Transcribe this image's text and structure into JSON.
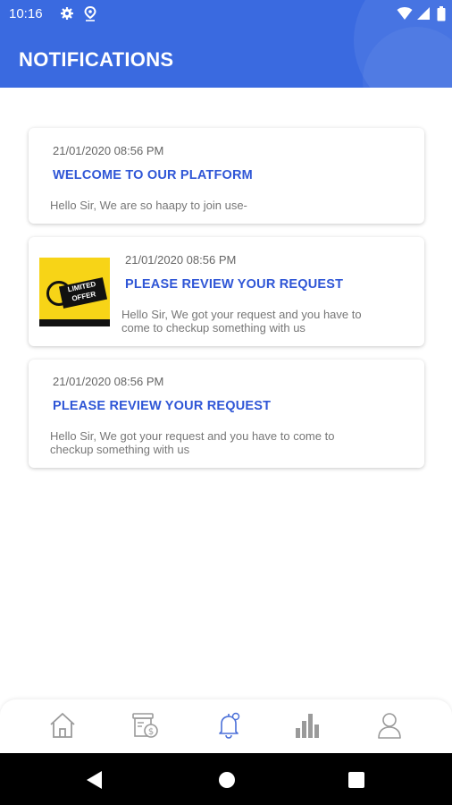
{
  "status_bar": {
    "time": "10:16",
    "icons": [
      "gear-icon",
      "location-pin-icon",
      "wifi-icon",
      "cellular-signal-icon",
      "battery-icon"
    ]
  },
  "header": {
    "title": "NOTIFICATIONS"
  },
  "notifications": [
    {
      "date": "21/01/2020 08:56 PM",
      "title": "WELCOME TO OUR PLATFORM",
      "body": "Hello Sir, We are so haapy to join use-",
      "has_image": false
    },
    {
      "date": "21/01/2020 08:56 PM",
      "title": "PLEASE REVIEW YOUR REQUEST",
      "body": "Hello Sir, We got your request and you have to come to checkup something with us",
      "has_image": true,
      "image": {
        "icon": "limited-offer-image",
        "text_line1": "LIMITED",
        "text_line2": "OFFER"
      }
    },
    {
      "date": "21/01/2020 08:56 PM",
      "title": "PLEASE REVIEW YOUR REQUEST",
      "body": "Hello Sir, We got your request and you have to come to checkup something with us",
      "has_image": false
    }
  ],
  "bottom_nav": {
    "items": [
      {
        "icon": "home-icon",
        "active": false
      },
      {
        "icon": "billing-icon",
        "active": false
      },
      {
        "icon": "bell-icon",
        "active": true
      },
      {
        "icon": "bar-chart-icon",
        "active": false
      },
      {
        "icon": "user-icon",
        "active": false
      }
    ]
  },
  "system_nav": {
    "icons": [
      "back-icon",
      "home-circle-icon",
      "recents-icon"
    ]
  },
  "colors": {
    "primary": "#3a6ae0",
    "title_blue": "#2f56d6",
    "nav_inactive": "#9a9a9a",
    "nav_active": "#4a6fd8",
    "offer_yellow": "#f7d417"
  }
}
